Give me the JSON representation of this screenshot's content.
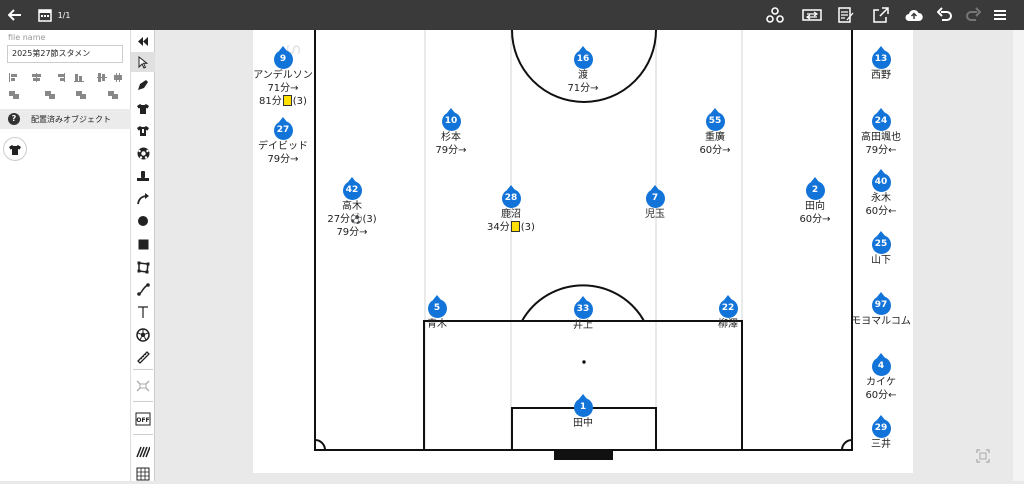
{
  "topbar": {
    "page_indicator": "1/1",
    "icons": [
      "back-arrow-icon",
      "calendar-icon",
      "share-nodes-icon",
      "swap-icon",
      "edit-note-icon",
      "export-icon",
      "cloud-upload-icon",
      "undo-icon",
      "redo-icon",
      "menu-icon"
    ]
  },
  "left_panel": {
    "file_name_label": "file name",
    "file_name_value": "2025第27節スタメン",
    "placed_objects_label": "配置済みオブジェクト"
  },
  "players": [
    {
      "id": "p9",
      "number": "9",
      "name": "アンデルソン",
      "sub": "71分→",
      "extra_prefix": "81分",
      "extra_card": "yellow",
      "extra_suffix": "(3)"
    },
    {
      "id": "p27",
      "number": "27",
      "name": "デイビッド",
      "sub": "79分→"
    },
    {
      "id": "p16",
      "number": "16",
      "name": "渡",
      "sub": "71分→"
    },
    {
      "id": "p13",
      "number": "13",
      "name": "西野"
    },
    {
      "id": "p10",
      "number": "10",
      "name": "杉本",
      "sub": "79分→"
    },
    {
      "id": "p55",
      "number": "55",
      "name": "重廣",
      "sub": "60分→"
    },
    {
      "id": "p24",
      "number": "24",
      "name": "高田颯也",
      "sub": "79分←"
    },
    {
      "id": "p42",
      "number": "42",
      "name": "高木",
      "sub": "27分⚽(3)",
      "extra_prefix": "79分→"
    },
    {
      "id": "p28",
      "number": "28",
      "name": "鹿沼",
      "sub": "34分",
      "sub_card": "yellow",
      "sub_suffix": "(3)"
    },
    {
      "id": "p7",
      "number": "7",
      "name": "児玉"
    },
    {
      "id": "p2",
      "number": "2",
      "name": "田向",
      "sub": "60分→"
    },
    {
      "id": "p40",
      "number": "40",
      "name": "永木",
      "sub": "60分←"
    },
    {
      "id": "p25",
      "number": "25",
      "name": "山下"
    },
    {
      "id": "p5",
      "number": "5",
      "name": "青木"
    },
    {
      "id": "p33",
      "number": "33",
      "name": "井上"
    },
    {
      "id": "p22",
      "number": "22",
      "name": "柳澤"
    },
    {
      "id": "p97",
      "number": "97",
      "name": "モヨマルコム"
    },
    {
      "id": "p4",
      "number": "4",
      "name": "カイケ",
      "sub": "60分←"
    },
    {
      "id": "p1",
      "number": "1",
      "name": "田中"
    },
    {
      "id": "p29",
      "number": "29",
      "name": "三井"
    }
  ],
  "colors": {
    "topbar": "#3a3a3a",
    "player_disc": "#1273d8",
    "yellow_card": "#ffe000"
  }
}
